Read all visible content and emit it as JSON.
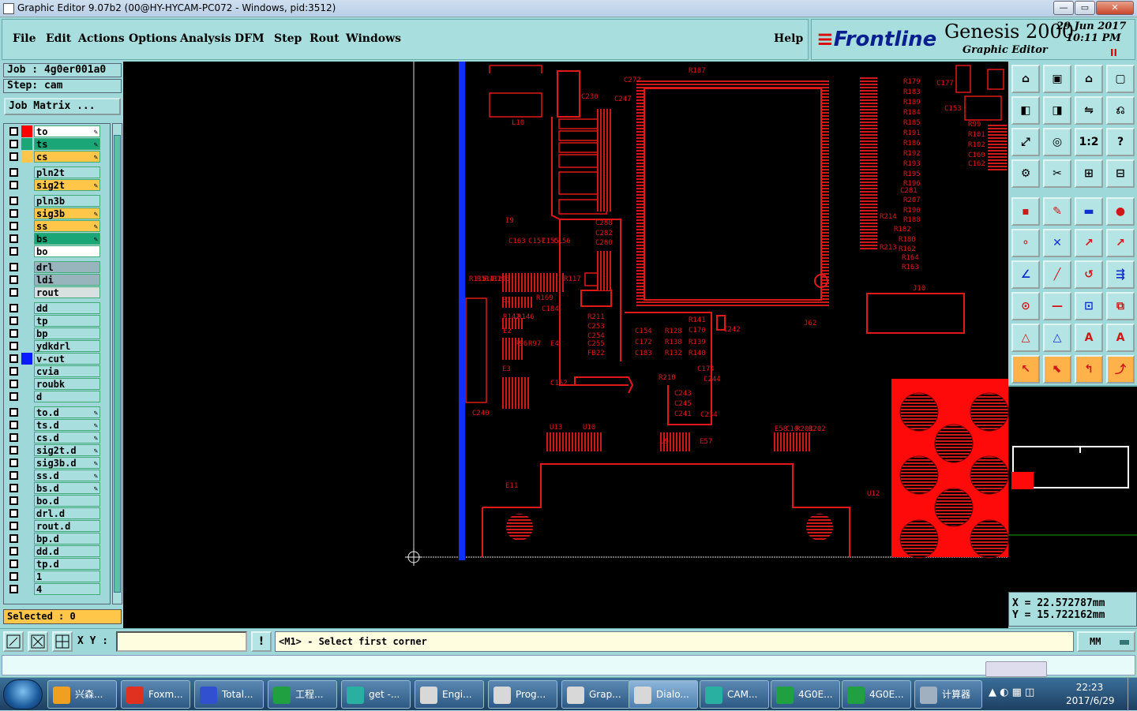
{
  "window": {
    "title": "Graphic Editor 9.07b2 (00@HY-HYCAM-PC072 - Windows, pid:3512)"
  },
  "menu": [
    "File",
    "Edit",
    "Actions",
    "Options",
    "Analysis",
    "DFM",
    "Step",
    "Rout",
    "Windows"
  ],
  "help": "Help",
  "brand": {
    "logo_pre": "Front",
    "logo_post": "line",
    "product": "Genesis 2000",
    "subtitle": "Graphic Editor",
    "date": "29 Jun 2017",
    "time": "10:11 PM",
    "pause": "II"
  },
  "job": {
    "job_label": "Job : 4g0er001a0",
    "step_label": "Step: cam",
    "matrix_button": "Job Matrix ..."
  },
  "layers": [
    {
      "name": "to",
      "color": "#ffffff",
      "swatch": "#ff0000",
      "edit": true
    },
    {
      "name": "ts",
      "color": "#1aa676",
      "swatch": "#1aa676",
      "edit": true
    },
    {
      "name": "cs",
      "color": "#ffc64a",
      "swatch": "#ffc64a",
      "edit": true
    },
    {
      "name": "pln2t",
      "color": "#a8dede",
      "swatch": "",
      "edit": false
    },
    {
      "name": "sig2t",
      "color": "#ffc64a",
      "swatch": "",
      "edit": true
    },
    {
      "name": "pln3b",
      "color": "#a8dede",
      "swatch": "",
      "edit": false
    },
    {
      "name": "sig3b",
      "color": "#ffc64a",
      "swatch": "",
      "edit": true
    },
    {
      "name": "ss",
      "color": "#ffc64a",
      "swatch": "",
      "edit": true
    },
    {
      "name": "bs",
      "color": "#1aa676",
      "swatch": "",
      "edit": true
    },
    {
      "name": "bo",
      "color": "#ffffff",
      "swatch": "",
      "edit": false
    },
    {
      "name": "drl",
      "color": "#98b4bc",
      "swatch": "",
      "edit": false
    },
    {
      "name": "ldi",
      "color": "#98b4bc",
      "swatch": "",
      "edit": false
    },
    {
      "name": "rout",
      "color": "#d8e0e0",
      "swatch": "",
      "edit": false
    },
    {
      "name": "dd",
      "color": "#a8dede",
      "swatch": "",
      "edit": false
    },
    {
      "name": "tp",
      "color": "#a8dede",
      "swatch": "",
      "edit": false
    },
    {
      "name": "bp",
      "color": "#a8dede",
      "swatch": "",
      "edit": false
    },
    {
      "name": "ydkdrl",
      "color": "#a8dede",
      "swatch": "",
      "edit": false
    },
    {
      "name": "v-cut",
      "color": "#a8dede",
      "swatch": "#0a1cff",
      "edit": false
    },
    {
      "name": "cvia",
      "color": "#a8dede",
      "swatch": "",
      "edit": false
    },
    {
      "name": "roubk",
      "color": "#a8dede",
      "swatch": "",
      "edit": false
    },
    {
      "name": "d",
      "color": "#a8dede",
      "swatch": "",
      "edit": false
    },
    {
      "name": "to.d",
      "color": "#a8dede",
      "swatch": "",
      "edit": true
    },
    {
      "name": "ts.d",
      "color": "#a8dede",
      "swatch": "",
      "edit": true
    },
    {
      "name": "cs.d",
      "color": "#a8dede",
      "swatch": "",
      "edit": true
    },
    {
      "name": "sig2t.d",
      "color": "#a8dede",
      "swatch": "",
      "edit": true
    },
    {
      "name": "sig3b.d",
      "color": "#a8dede",
      "swatch": "",
      "edit": true
    },
    {
      "name": "ss.d",
      "color": "#a8dede",
      "swatch": "",
      "edit": true
    },
    {
      "name": "bs.d",
      "color": "#a8dede",
      "swatch": "",
      "edit": true
    },
    {
      "name": "bo.d",
      "color": "#a8dede",
      "swatch": "",
      "edit": false
    },
    {
      "name": "drl.d",
      "color": "#a8dede",
      "swatch": "",
      "edit": false
    },
    {
      "name": "rout.d",
      "color": "#a8dede",
      "swatch": "",
      "edit": false
    },
    {
      "name": "bp.d",
      "color": "#a8dede",
      "swatch": "",
      "edit": false
    },
    {
      "name": "dd.d",
      "color": "#a8dede",
      "swatch": "",
      "edit": false
    },
    {
      "name": "tp.d",
      "color": "#a8dede",
      "swatch": "",
      "edit": false
    },
    {
      "name": "1",
      "color": "#a8dede",
      "swatch": "",
      "edit": false
    },
    {
      "name": "4",
      "color": "#a8dede",
      "swatch": "",
      "edit": false
    }
  ],
  "selected": "Selected : 0",
  "coords": {
    "x": "X = 22.572787mm",
    "y": "Y = 15.722162mm"
  },
  "bottom": {
    "xy_label": "X Y :",
    "prompt": "<M1> - Select first corner",
    "units": "MM",
    "alert": "!"
  },
  "pcb_labels": [
    "L10",
    "I9",
    "R187",
    "C272",
    "C230",
    "C247",
    "R179",
    "R183",
    "R189",
    "R184",
    "R185",
    "R191",
    "R186",
    "R192",
    "R193",
    "R195",
    "R196",
    "C281",
    "R207",
    "R190",
    "R188",
    "R182",
    "R180",
    "R162",
    "R164",
    "R163",
    "R214",
    "R213",
    "C153",
    "R99",
    "R101",
    "R102",
    "C160",
    "C162",
    "C177",
    "C288",
    "C282",
    "C280",
    "C163",
    "C157",
    "C155",
    "C156",
    "R115",
    "R114",
    "R112",
    "R105",
    "R117",
    "E1",
    "R169",
    "C184",
    "R142",
    "R146",
    "R211",
    "C253",
    "C254",
    "C255",
    "FB22",
    "E2",
    "R96",
    "R97",
    "E3",
    "E4",
    "C152",
    "C154",
    "R128",
    "R141",
    "C170",
    "C172",
    "R138",
    "R139",
    "C183",
    "R132",
    "R140",
    "C174",
    "C244",
    "C242",
    "R210",
    "C243",
    "C245",
    "C241",
    "C234",
    "C240",
    "J10",
    "J62",
    "U12",
    "U13",
    "U10",
    "U9",
    "E57",
    "E58",
    "C10",
    "R201",
    "R202",
    "E11",
    "J58"
  ],
  "taskbar": {
    "tasks": [
      {
        "label": "兴森...",
        "color": "#f0a020"
      },
      {
        "label": "Foxm...",
        "color": "#e03020"
      },
      {
        "label": "Total...",
        "color": "#3050d0"
      },
      {
        "label": "工程...",
        "color": "#20a040"
      },
      {
        "label": "get -...",
        "color": "#2ab0a0"
      },
      {
        "label": "Engi...",
        "color": "#d8d8d8"
      },
      {
        "label": "Prog...",
        "color": "#d8d8d8"
      },
      {
        "label": "Grap...",
        "color": "#d8d8d8"
      },
      {
        "label": "Dialo...",
        "color": "#d8d8d8"
      },
      {
        "label": "CAM...",
        "color": "#2ab0a0"
      },
      {
        "label": "4G0E...",
        "color": "#20a040"
      },
      {
        "label": "4G0E...",
        "color": "#20a040"
      },
      {
        "label": "计算器",
        "color": "#a0b0c0"
      }
    ],
    "time": "22:23",
    "date": "2017/6/29"
  }
}
